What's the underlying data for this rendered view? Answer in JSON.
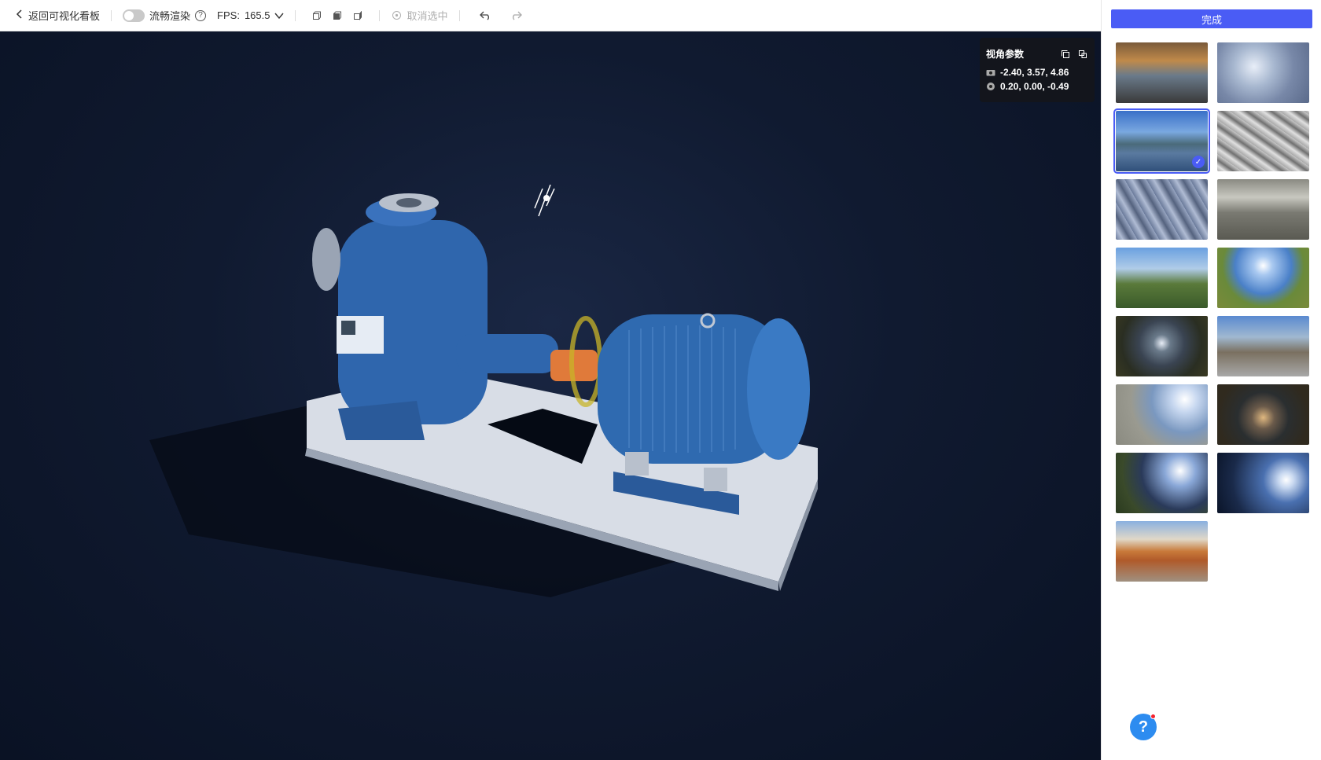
{
  "toolbar": {
    "back_label": "返回可视化看板",
    "smooth_label": "流畅渲染",
    "help_glyph": "?",
    "fps_label": "FPS:",
    "fps_value": "165.5",
    "deselect_label": "取消选中",
    "icons": [
      "chevron-left-icon",
      "toggle-switch",
      "help-circle-icon",
      "chevron-down-icon",
      "view-front-icon",
      "view-top-icon",
      "view-side-icon",
      "deselect-icon",
      "undo-icon",
      "redo-icon"
    ]
  },
  "viewport": {
    "background_color": "#0f1830",
    "param_box": {
      "title": "视角参数",
      "camera_position": "-2.40, 3.57, 4.86",
      "target_position": "0.20, 0.00, -0.49",
      "icons": [
        "copy-icon",
        "paste-icon",
        "camera-icon",
        "target-icon"
      ]
    }
  },
  "panel": {
    "done_label": "完成",
    "accent_color": "#4a5cf5",
    "selected_index": 2,
    "thumbnails": [
      {
        "name": "hdr-hall"
      },
      {
        "name": "hdr-crystal"
      },
      {
        "name": "hdr-harbor"
      },
      {
        "name": "hdr-ice"
      },
      {
        "name": "hdr-silk"
      },
      {
        "name": "hdr-warehouse"
      },
      {
        "name": "hdr-meadow"
      },
      {
        "name": "hdr-field-sun"
      },
      {
        "name": "hdr-night-field"
      },
      {
        "name": "hdr-church-square"
      },
      {
        "name": "hdr-plaza"
      },
      {
        "name": "hdr-dusk-field"
      },
      {
        "name": "hdr-grass-sky"
      },
      {
        "name": "hdr-night-sky"
      },
      {
        "name": "hdr-temple"
      }
    ],
    "help_glyph": "?"
  }
}
